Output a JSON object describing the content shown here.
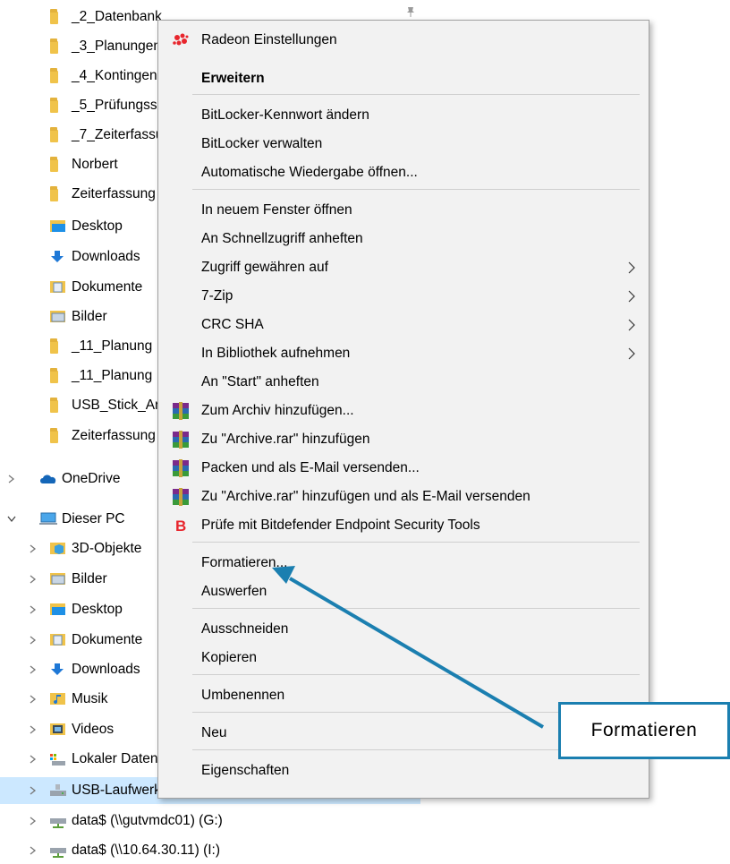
{
  "tree": {
    "quick_access": [
      {
        "label": "_2_Datenbank",
        "icon": "folder-icon"
      },
      {
        "label": "_3_Planungen",
        "icon": "folder-icon"
      },
      {
        "label": "_4_Kontingen",
        "icon": "folder-icon"
      },
      {
        "label": "_5_Prüfungss",
        "icon": "folder-icon"
      },
      {
        "label": "_7_Zeiterfassu",
        "icon": "folder-icon"
      },
      {
        "label": "Norbert",
        "icon": "folder-icon"
      },
      {
        "label": "Zeiterfassung",
        "icon": "folder-icon"
      },
      {
        "label": "Desktop",
        "icon": "desktop-folder-icon"
      },
      {
        "label": "Downloads",
        "icon": "downloads-folder-icon"
      },
      {
        "label": "Dokumente",
        "icon": "documents-folder-icon"
      },
      {
        "label": "Bilder",
        "icon": "pictures-folder-icon"
      },
      {
        "label": "_11_Planung",
        "icon": "folder-icon"
      },
      {
        "label": "_11_Planung",
        "icon": "folder-icon"
      },
      {
        "label": "USB_Stick_An",
        "icon": "folder-icon"
      },
      {
        "label": "Zeiterfassung",
        "icon": "folder-icon"
      }
    ],
    "onedrive": {
      "label": "OneDrive",
      "icon": "onedrive-cloud-icon"
    },
    "this_pc": {
      "label": "Dieser PC",
      "icon": "computer-icon"
    },
    "pc_children": [
      {
        "label": "3D-Objekte",
        "icon": "3d-objects-icon"
      },
      {
        "label": "Bilder",
        "icon": "pictures-folder-icon"
      },
      {
        "label": "Desktop",
        "icon": "desktop-folder-icon"
      },
      {
        "label": "Dokumente",
        "icon": "documents-folder-icon"
      },
      {
        "label": "Downloads",
        "icon": "downloads-folder-icon"
      },
      {
        "label": "Musik",
        "icon": "music-folder-icon"
      },
      {
        "label": "Videos",
        "icon": "videos-folder-icon"
      },
      {
        "label": "Lokaler Datenträger",
        "icon": "local-disk-icon"
      },
      {
        "label": "USB-Laufwerk (D:)",
        "icon": "usb-drive-icon"
      },
      {
        "label": "data$ (\\\\gutvmdc01) (G:)",
        "icon": "network-drive-icon"
      },
      {
        "label": "data$ (\\\\10.64.30.11) (I:)",
        "icon": "network-drive-icon"
      }
    ],
    "selected_color": "#cce8ff"
  },
  "menu": {
    "items": [
      {
        "label": "Radeon Einstellungen",
        "icon": "radeon-icon"
      },
      {
        "label": "Erweitern",
        "bold": true
      },
      {
        "label": "BitLocker-Kennwort ändern"
      },
      {
        "label": "BitLocker verwalten"
      },
      {
        "label": "Automatische Wiedergabe öffnen..."
      },
      {
        "label": "In neuem Fenster öffnen"
      },
      {
        "label": "An Schnellzugriff anheften"
      },
      {
        "label": "Zugriff gewähren auf",
        "submenu": true
      },
      {
        "label": "7-Zip",
        "submenu": true
      },
      {
        "label": "CRC SHA",
        "submenu": true
      },
      {
        "label": "In Bibliothek aufnehmen",
        "submenu": true
      },
      {
        "label": "An \"Start\" anheften"
      },
      {
        "label": "Zum Archiv hinzufügen...",
        "icon": "winrar-icon"
      },
      {
        "label": "Zu \"Archive.rar\" hinzufügen",
        "icon": "winrar-icon"
      },
      {
        "label": "Packen und als E-Mail versenden...",
        "icon": "winrar-icon"
      },
      {
        "label": "Zu \"Archive.rar\" hinzufügen und als E-Mail versenden",
        "icon": "winrar-icon"
      },
      {
        "label": "Prüfe mit Bitdefender Endpoint Security Tools",
        "icon": "bitdefender-icon"
      },
      {
        "label": "Formatieren..."
      },
      {
        "label": "Auswerfen"
      },
      {
        "label": "Ausschneiden"
      },
      {
        "label": "Kopieren"
      },
      {
        "label": "Umbenennen"
      },
      {
        "label": "Neu",
        "submenu": true
      },
      {
        "label": "Eigenschaften"
      }
    ],
    "submenu_icon": "chevron-right-icon"
  },
  "callout": {
    "label": "Formatieren",
    "color": "#1b7fb0"
  },
  "colors": {
    "menu_background": "#f2f2f2",
    "folder": "#f0c34a",
    "accent": "#1b7fb0"
  }
}
